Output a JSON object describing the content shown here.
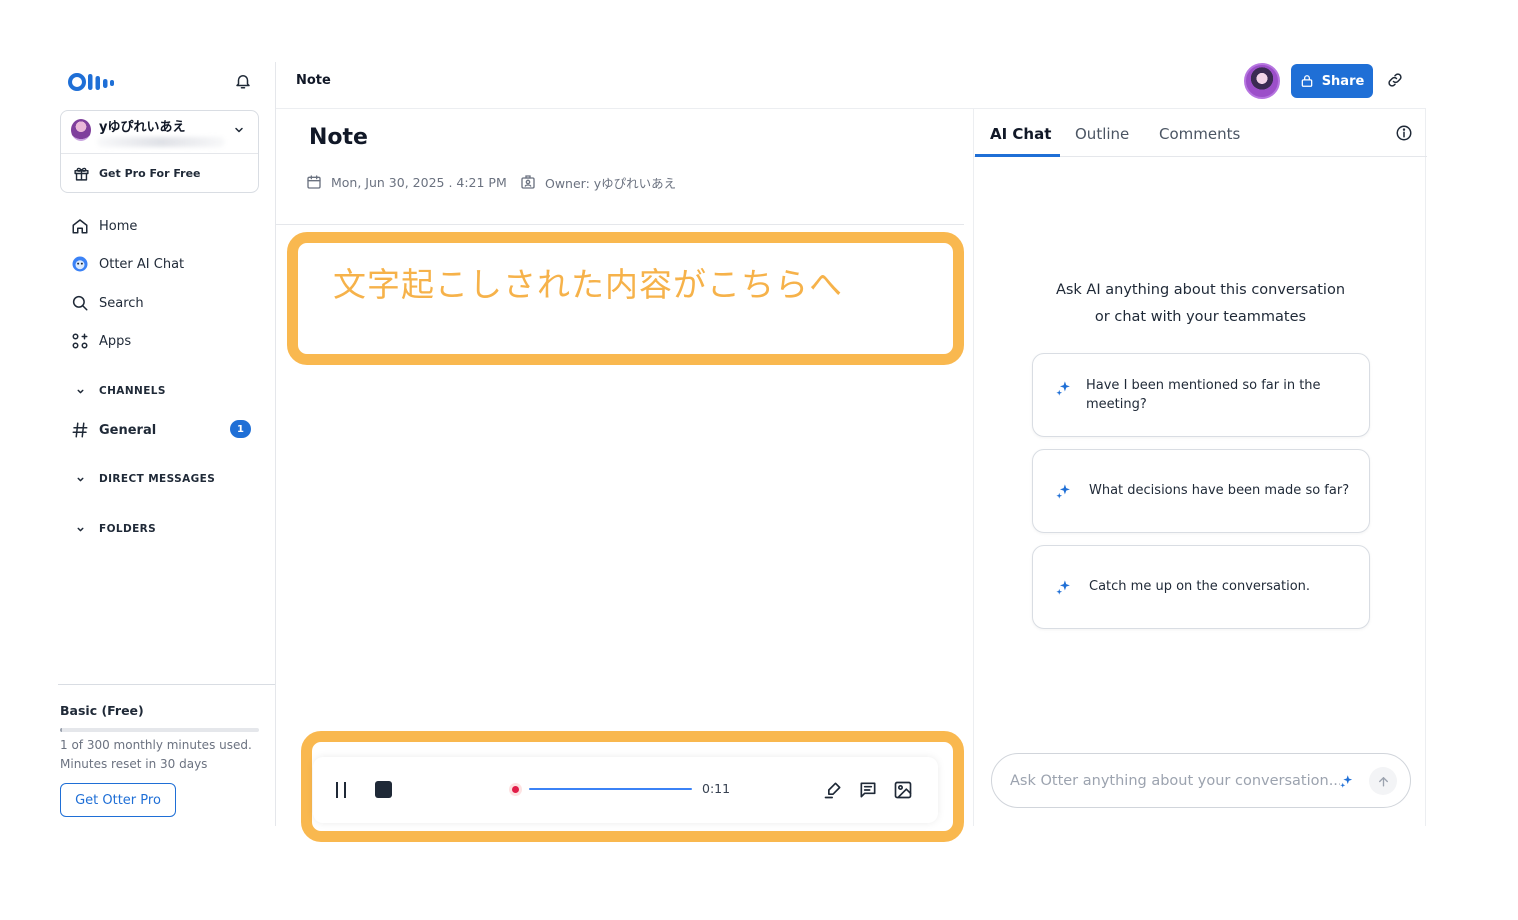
{
  "sidebar": {
    "account_name": "yゆぴれいあえ",
    "get_pro_label": "Get Pro For Free",
    "nav": [
      {
        "label": "Home",
        "icon": "home-icon"
      },
      {
        "label": "Otter AI Chat",
        "icon": "otter-icon"
      },
      {
        "label": "Search",
        "icon": "search-icon"
      },
      {
        "label": "Apps",
        "icon": "apps-icon"
      }
    ],
    "channels_label": "CHANNELS",
    "channel_general": "General",
    "channel_general_badge": "1",
    "direct_messages_label": "DIRECT MESSAGES",
    "folders_label": "FOLDERS",
    "plan": {
      "title": "Basic (Free)",
      "usage": "1 of 300 monthly minutes used.",
      "usage_fraction": 0.0033,
      "reset": "Minutes reset in 30 days",
      "cta": "Get Otter Pro"
    }
  },
  "header": {
    "title": "Note",
    "share_label": "Share"
  },
  "note": {
    "title": "Note",
    "date": "Mon, Jun 30, 2025 . 4:21 PM",
    "owner": "Owner: yゆぴれいあえ",
    "transcript_annotation": "文字起こしされた内容がこちらへ"
  },
  "player": {
    "time": "0:11"
  },
  "ai_panel": {
    "tabs": [
      "AI Chat",
      "Outline",
      "Comments"
    ],
    "active_tab": "AI Chat",
    "prompt_line1": "Ask AI anything about this conversation",
    "prompt_line2": "or chat with your teammates",
    "suggestions": [
      "Have I been mentioned so far in the meeting?",
      "What decisions have been made so far?",
      "Catch me up on the conversation."
    ],
    "input_placeholder": "Ask Otter anything about your conversation..."
  },
  "colors": {
    "accent": "#1f6fd6",
    "annotation": "#f9b84f",
    "recording": "#e11d48"
  }
}
